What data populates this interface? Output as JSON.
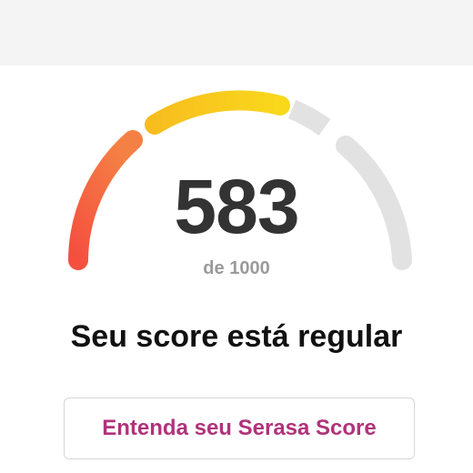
{
  "score": {
    "value": "583",
    "max_label": "de 1000",
    "fraction": 0.583
  },
  "status": {
    "text": "Seu score está regular"
  },
  "cta": {
    "label": "Entenda seu Serasa Score"
  },
  "colors": {
    "low": "#f25b46",
    "medium": "#f7c51f",
    "inactive": "#e2e2e2",
    "score_text": "#333333",
    "cta_text": "#b0337a"
  }
}
